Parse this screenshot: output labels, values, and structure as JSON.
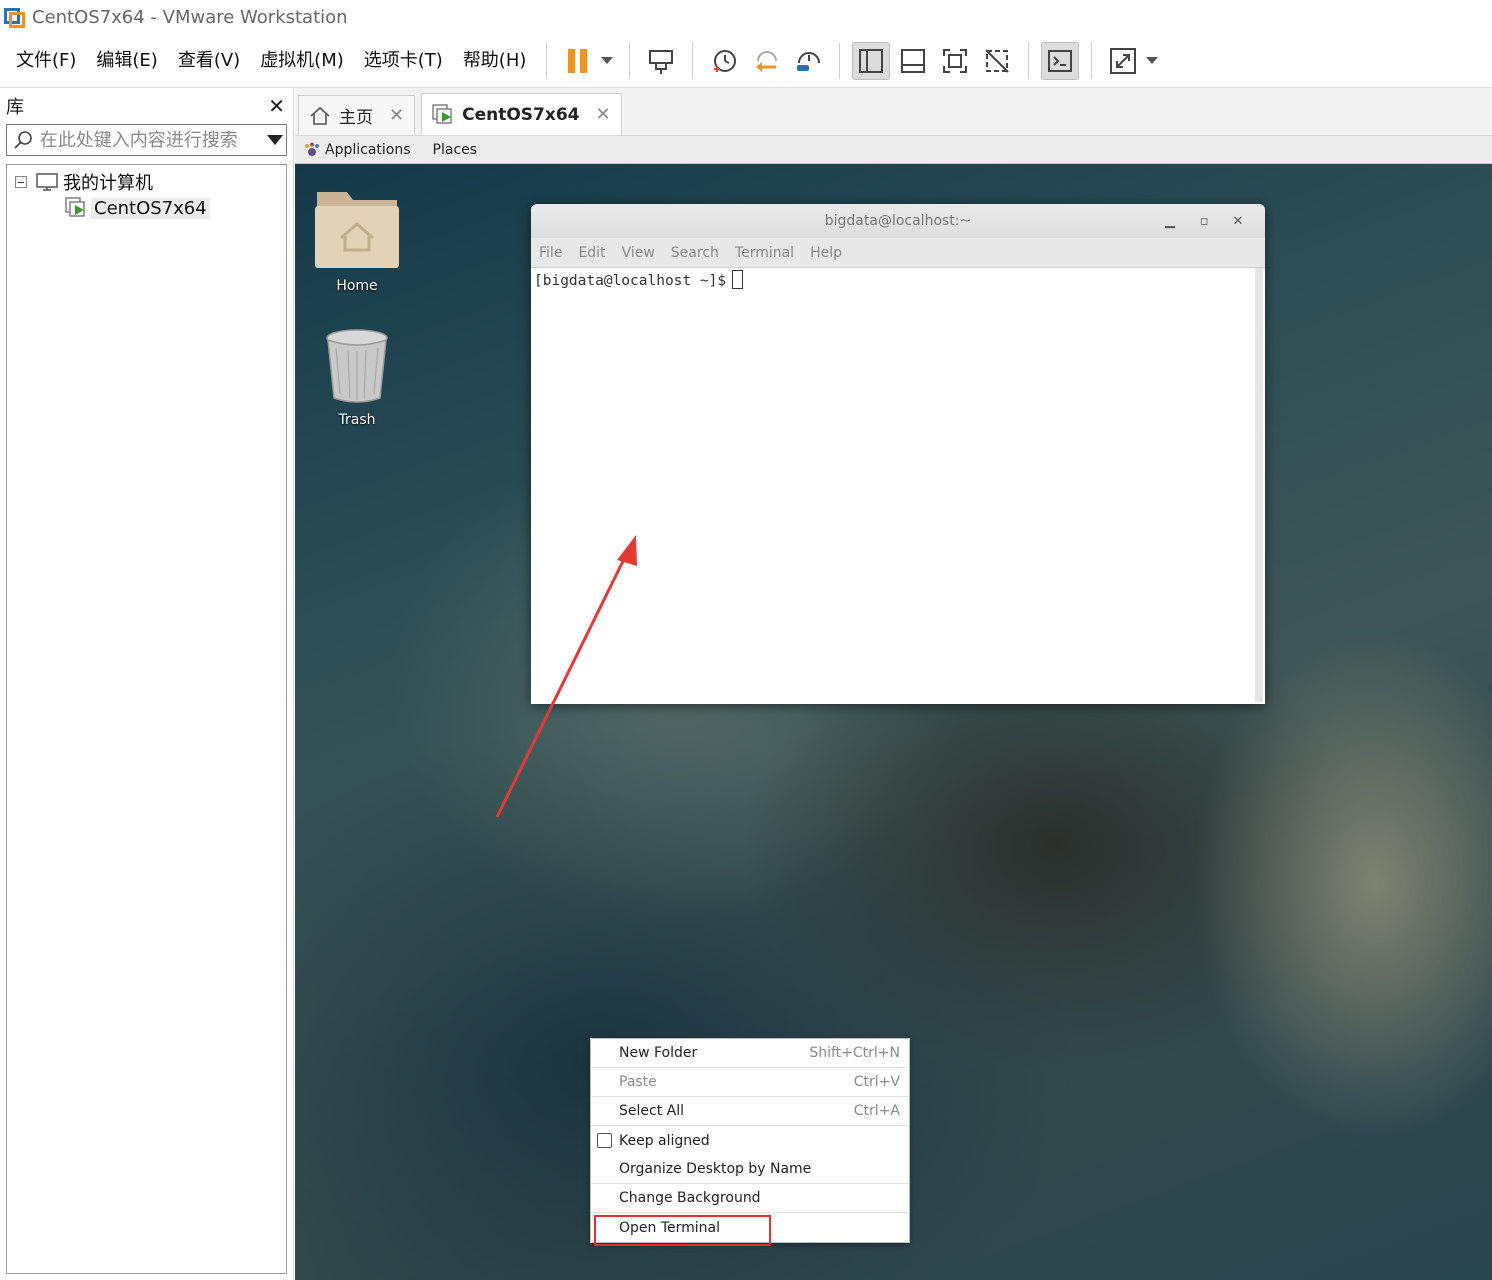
{
  "window": {
    "title": "CentOS7x64 - VMware Workstation"
  },
  "menubar": {
    "items": [
      "文件(F)",
      "编辑(E)",
      "查看(V)",
      "虚拟机(M)",
      "选项卡(T)",
      "帮助(H)"
    ]
  },
  "toolbar": {
    "buttons": [
      "pause-icon",
      "send-ctrl-alt-del-icon",
      "snapshot-take-icon",
      "snapshot-revert-icon",
      "snapshot-manager-icon",
      "show-library-icon",
      "thumbnail-bar-icon",
      "fullscreen-icon",
      "unity-icon",
      "console-view-icon",
      "stretch-guest-icon"
    ],
    "accent": "#f0922a"
  },
  "library": {
    "title": "库",
    "search_placeholder": "在此处键入内容进行搜索",
    "tree": {
      "root": "我的计算机",
      "children": [
        "CentOS7x64"
      ]
    }
  },
  "tabs": [
    {
      "label": "主页",
      "icon": "home-icon"
    },
    {
      "label": "CentOS7x64",
      "icon": "vm-running-icon",
      "active": true
    }
  ],
  "guest": {
    "topbar": {
      "applications": "Applications",
      "places": "Places"
    },
    "desktop_icons": [
      {
        "label": "Home",
        "icon": "home-folder-icon"
      },
      {
        "label": "Trash",
        "icon": "trash-icon"
      }
    ],
    "terminal": {
      "title": "bigdata@localhost:~",
      "menu": [
        "File",
        "Edit",
        "View",
        "Search",
        "Terminal",
        "Help"
      ],
      "prompt": "[bigdata@localhost ~]$"
    },
    "context_menu": {
      "items": [
        {
          "label": "New Folder",
          "accel": "Shift+Ctrl+N"
        },
        {
          "label": "Paste",
          "accel": "Ctrl+V",
          "disabled": true
        },
        {
          "label": "Select All",
          "accel": "Ctrl+A"
        },
        {
          "label": "Keep aligned",
          "checkbox": true,
          "checked": false
        },
        {
          "label": "Organize Desktop by Name"
        },
        {
          "label": "Change Background"
        },
        {
          "label": "Open Terminal",
          "highlighted": true
        }
      ]
    }
  },
  "annotation": {
    "color": "#e53935"
  }
}
